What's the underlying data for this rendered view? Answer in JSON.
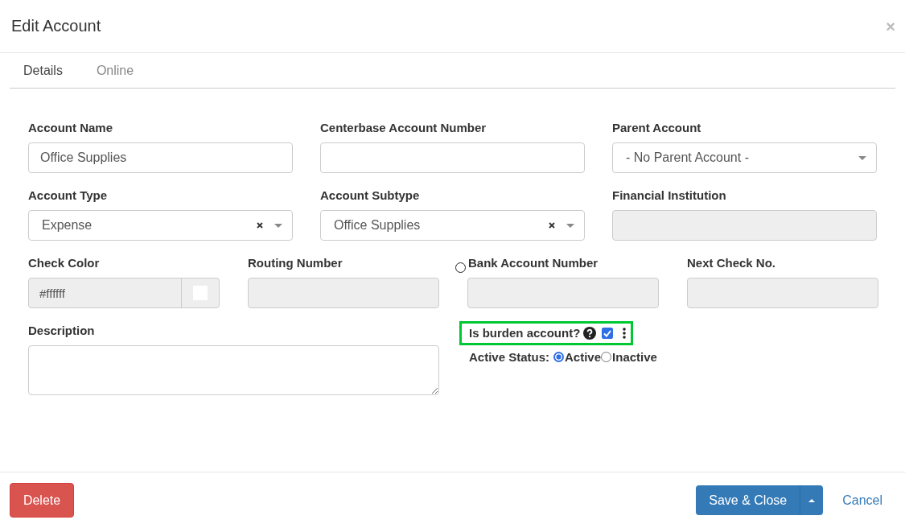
{
  "window": {
    "title": "Edit Account",
    "close": "×"
  },
  "tabs": [
    {
      "label": "Details",
      "selected": true
    },
    {
      "label": "Online",
      "selected": false
    }
  ],
  "rows": [
    {
      "fields": [
        {
          "label": "Account Name",
          "kind": "text",
          "value": "Office Supplies",
          "disabled": false
        },
        {
          "label": "Centerbase Account Number",
          "kind": "text",
          "disabled": false
        },
        {
          "label": "Parent Account",
          "kind": "select",
          "value": "- No Parent Account -",
          "clearable": false,
          "disabled": false
        }
      ]
    },
    {
      "fields": [
        {
          "label": "Account Type",
          "kind": "select",
          "value": "Expense",
          "clearable": true,
          "disabled": false
        },
        {
          "label": "Account Subtype",
          "kind": "select",
          "value": "Office Supplies",
          "clearable": true,
          "disabled": false
        },
        {
          "label": "Financial Institution",
          "kind": "text",
          "disabled": true
        }
      ]
    },
    {
      "fields": [
        {
          "label": "Check Color",
          "kind": "color",
          "value": "#ffffff",
          "disabled": true
        },
        {
          "label": "Routing Number",
          "kind": "text",
          "disabled": true
        },
        {
          "label": "Bank Account Number",
          "kind": "text",
          "disabled": true,
          "radio": {
            "selected": false
          }
        },
        {
          "label": "Next Check No.",
          "kind": "text",
          "disabled": true
        }
      ]
    }
  ],
  "description": {
    "label": "Description"
  },
  "burden": {
    "label": "Is burden account?",
    "checked": true,
    "highlighted": true
  },
  "active_status": {
    "label": "Active Status:",
    "options": [
      {
        "label": "Active",
        "selected": true
      },
      {
        "label": "Inactive",
        "selected": false
      }
    ]
  },
  "footer": {
    "delete": "Delete",
    "save": "Save & Close",
    "cancel": "Cancel"
  }
}
